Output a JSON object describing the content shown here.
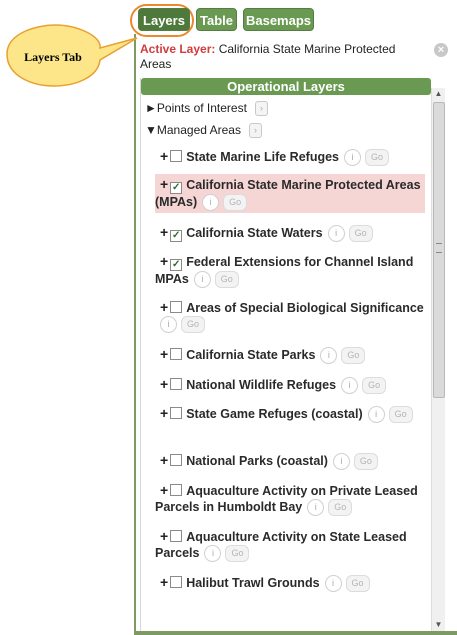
{
  "callout": {
    "text": "Layers Tab"
  },
  "tabs": [
    {
      "label": "Layers"
    },
    {
      "label": "Table"
    },
    {
      "label": "Basemaps"
    }
  ],
  "active_layer": {
    "label": "Active Layer:",
    "value": "California State Marine Protected Areas"
  },
  "panel": {
    "header": "Operational Layers",
    "groups": [
      {
        "label": "Points of Interest",
        "arrow": "►"
      },
      {
        "label": "Managed Areas",
        "arrow": "▼"
      }
    ],
    "layers": [
      {
        "name": "State Marine Life Refuges",
        "checked": false
      },
      {
        "name": "California State Marine Protected Areas (MPAs)",
        "checked": true
      },
      {
        "name": "California State Waters",
        "checked": true
      },
      {
        "name": "Federal Extensions for Channel Island MPAs",
        "checked": true
      },
      {
        "name": "Areas of Special Biological Significance",
        "checked": false
      },
      {
        "name": "California State Parks",
        "checked": false
      },
      {
        "name": "National Wildlife Refuges",
        "checked": false
      },
      {
        "name": "State Game Refuges (coastal)",
        "checked": false
      },
      {
        "name": "National Parks (coastal)",
        "checked": false
      },
      {
        "name": "Aquaculture Activity on Private Leased Parcels in Humboldt Bay",
        "checked": false
      },
      {
        "name": "Aquaculture Activity on State Leased Parcels",
        "checked": false
      },
      {
        "name": "Halibut Trawl Grounds",
        "checked": false
      }
    ],
    "info_label": "i",
    "go_label": "Go",
    "expand_label": "+"
  },
  "colors": {
    "tab_green": "#6a9a52",
    "active_label": "#d23c3c",
    "highlight_row": "#f6d5d5",
    "callout_fill": "#fde68a",
    "callout_border": "#e8a02f"
  }
}
